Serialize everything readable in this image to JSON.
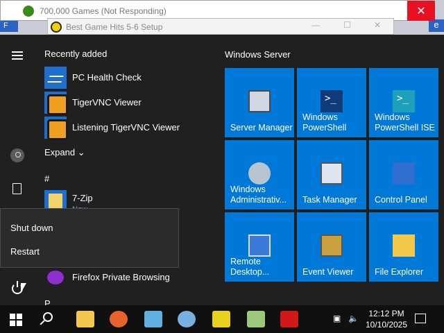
{
  "background_windows": {
    "window1_title": "700,000 Games (Not Responding)",
    "window1_close": "✕",
    "window2_title": "Best Game Hits 5-6 Setup",
    "window2_min": "—",
    "window2_max": "☐",
    "window2_close": "✕",
    "left_strip": "F",
    "right_strip": "e",
    "top_right_glyph": "?"
  },
  "start_menu": {
    "recently_added_label": "Recently added",
    "recent_apps": [
      {
        "label": "PC Health Check",
        "icon": "pc-health-check-icon"
      },
      {
        "label": "TigerVNC Viewer",
        "icon": "tigervnc-icon"
      },
      {
        "label": "Listening TigerVNC Viewer",
        "icon": "tigervnc-icon"
      }
    ],
    "expand_label": "Expand",
    "hash_header": "#",
    "zip_app": {
      "label": "7-Zip",
      "sub": "New"
    },
    "firefox_app": {
      "label": "Firefox Private Browsing"
    },
    "p_header": "P",
    "power_menu": {
      "shut_down": "Shut down",
      "restart": "Restart"
    }
  },
  "tiles_section": {
    "title": "Windows Server",
    "tiles": [
      {
        "label": "Server Manager",
        "icon": "server-manager-icon"
      },
      {
        "label": "Windows PowerShell",
        "icon": "powershell-icon"
      },
      {
        "label": "Windows PowerShell ISE",
        "icon": "powershell-ise-icon"
      },
      {
        "label": "Windows Administrativ...",
        "icon": "admin-tools-icon"
      },
      {
        "label": "Task Manager",
        "icon": "task-manager-icon"
      },
      {
        "label": "Control Panel",
        "icon": "control-panel-icon"
      },
      {
        "label": "Remote Desktop...",
        "icon": "remote-desktop-icon"
      },
      {
        "label": "Event Viewer",
        "icon": "event-viewer-icon"
      },
      {
        "label": "File Explorer",
        "icon": "file-explorer-icon"
      }
    ]
  },
  "taskbar": {
    "clock_time": "12:12 PM",
    "clock_date": "10/10/2025"
  },
  "colors": {
    "tile_blue": "#0078d7",
    "menu_bg": "#202020",
    "taskbar_bg": "#101010",
    "close_red": "#e81123"
  }
}
